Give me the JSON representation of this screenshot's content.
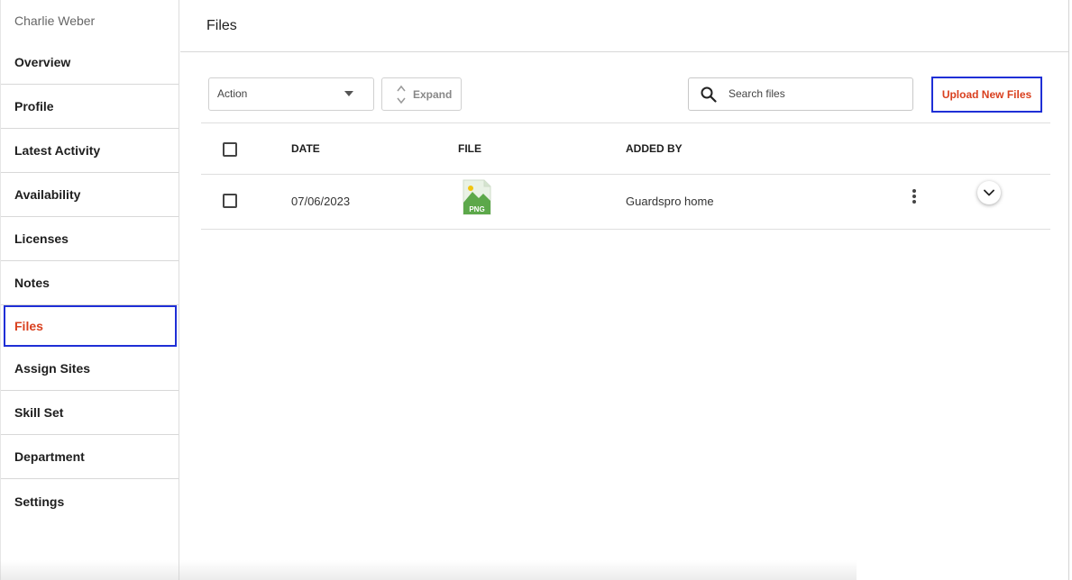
{
  "sidebar": {
    "user_name": "Charlie Weber",
    "items": [
      {
        "label": "Overview"
      },
      {
        "label": "Profile"
      },
      {
        "label": "Latest Activity"
      },
      {
        "label": "Availability"
      },
      {
        "label": "Licenses"
      },
      {
        "label": "Notes"
      },
      {
        "label": "Files",
        "active": true
      },
      {
        "label": "Assign Sites"
      },
      {
        "label": "Skill Set"
      },
      {
        "label": "Department"
      },
      {
        "label": "Settings"
      }
    ]
  },
  "header": {
    "title": "Files"
  },
  "toolbar": {
    "action_label": "Action",
    "expand_label": "Expand",
    "search_placeholder": "Search files",
    "upload_label": "Upload New Files"
  },
  "table": {
    "columns": [
      "DATE",
      "FILE",
      "ADDED BY"
    ],
    "rows": [
      {
        "date": "07/06/2023",
        "file_type": "PNG",
        "added_by": "Guardspro home"
      }
    ]
  },
  "colors": {
    "accent": "#d9401f",
    "highlight_border": "#1f2fd6",
    "file_icon_green": "#5ca84a"
  },
  "icons": {
    "search": "search-icon",
    "expand": "chevron-up-down-icon",
    "action_caret": "caret-down-icon",
    "row_menu": "kebab-menu-icon",
    "row_expand": "chevron-down-icon",
    "file": "png-file-icon"
  }
}
